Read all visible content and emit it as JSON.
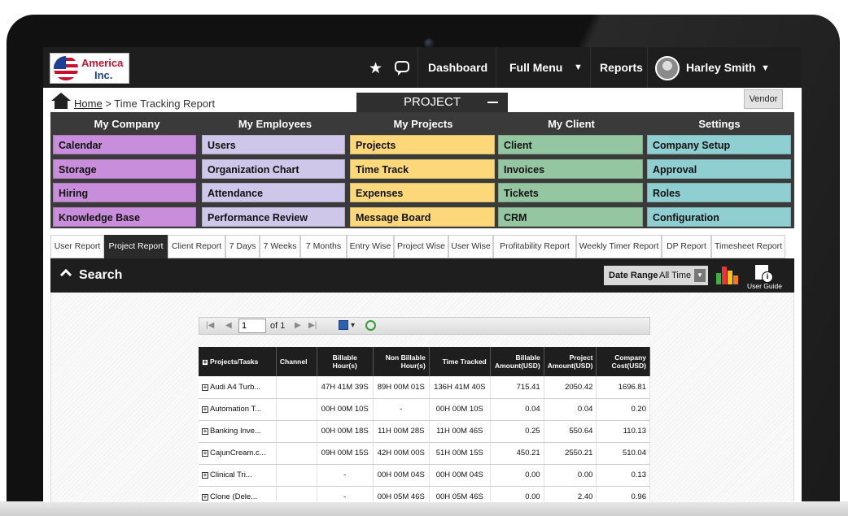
{
  "topnav": {
    "logo_line1": "America",
    "logo_line2": "Inc.",
    "icons": [
      "star-icon",
      "chat-icon"
    ],
    "items": [
      "Dashboard",
      "Full Menu",
      "Reports"
    ],
    "user_name": "Harley Smith"
  },
  "breadcrumb": {
    "home": "Home",
    "current": "> Time Tracking Report"
  },
  "project_tab": "PROJECT",
  "vendor_label": "Vendor",
  "menu": {
    "columns": [
      {
        "title": "My Company",
        "items": [
          "Calendar",
          "Storage",
          "Hiring",
          "Knowledge Base"
        ],
        "color": "#c98edb"
      },
      {
        "title": "My Employees",
        "items": [
          "Users",
          "Organization Chart",
          "Attendance",
          "Performance Review"
        ],
        "color": "#cfc7ea"
      },
      {
        "title": "My Projects",
        "items": [
          "Projects",
          "Time Track",
          "Expenses",
          "Message Board"
        ],
        "color": "#fcd87a"
      },
      {
        "title": "My Client",
        "items": [
          "Client",
          "Invoices",
          "Tickets",
          "CRM"
        ],
        "color": "#93c6a1"
      },
      {
        "title": "Settings",
        "items": [
          "Company Setup",
          "Approval",
          "Roles",
          "Configuration"
        ],
        "color": "#8fcfd2"
      }
    ]
  },
  "report_tabs": [
    "User Report",
    "Project Report",
    "Client Report",
    "7 Days",
    "7 Weeks",
    "7 Months",
    "Entry Wise",
    "Project Wise",
    "User Wise",
    "Profitability Report",
    "Weekly Timer Report",
    "DP Report",
    "Timesheet Report"
  ],
  "active_tab": "Project Report",
  "search": {
    "label": "Search",
    "date_range_label": "Date Range",
    "date_range_value": "All Time",
    "user_guide": "User Guide"
  },
  "toolbar": {
    "page": "1",
    "of_label": "of 1"
  },
  "table": {
    "headers": [
      "Projects/Tasks",
      "Channel",
      "Billable Hour(s)",
      "Non Billable Hour(s)",
      "Time Tracked",
      "Billable Amount(USD)",
      "Project Amount(USD)",
      "Company Cost(USD)"
    ],
    "rows": [
      [
        "Audi A4 Turb...",
        "",
        "47H 41M 39S",
        "89H 00M 01S",
        "136H 41M 40S",
        "715.41",
        "2050.42",
        "1696.81"
      ],
      [
        "Automation T...",
        "",
        "00H 00M 10S",
        "-",
        "00H 00M 10S",
        "0.04",
        "0.04",
        "0.20"
      ],
      [
        "Banking Inve...",
        "",
        "00H 00M 18S",
        "11H 00M 28S",
        "11H 00M 46S",
        "0.25",
        "550.64",
        "110.13"
      ],
      [
        "CajunCream.c...",
        "",
        "09H 00M 15S",
        "42H 00M 00S",
        "51H 00M 15S",
        "450.21",
        "2550.21",
        "510.04"
      ],
      [
        "Clinical Tri...",
        "",
        "-",
        "00H 00M 04S",
        "00H 00M 04S",
        "0.00",
        "0.00",
        "0.13"
      ],
      [
        "Clone  (Dele...",
        "",
        "-",
        "00H 05M 46S",
        "00H 05M 46S",
        "0.00",
        "2.40",
        "0.96"
      ]
    ]
  }
}
